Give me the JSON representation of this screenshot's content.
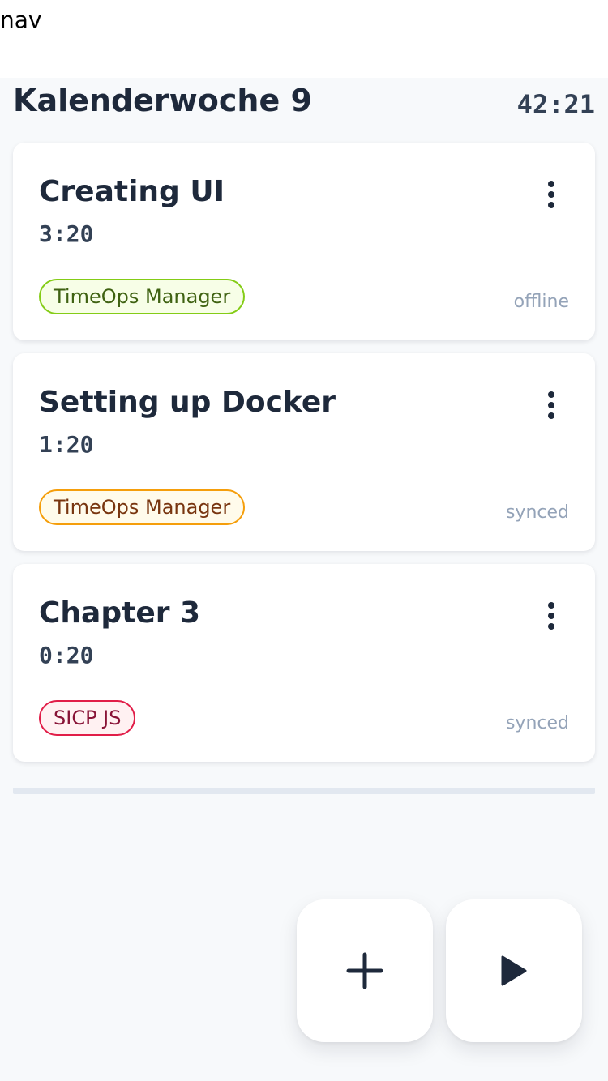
{
  "nav": {
    "label": "nav"
  },
  "week": {
    "title": "Kalenderwoche 9",
    "total": "42:21"
  },
  "entries": [
    {
      "title": "Creating UI",
      "duration": "3:20",
      "tag": "TimeOps Manager",
      "tag_colors": {
        "border": "#84cc16",
        "background": "#f7fee7",
        "text": "#3f6212"
      },
      "status": "offline"
    },
    {
      "title": "Setting up Docker",
      "duration": "1:20",
      "tag": "TimeOps Manager",
      "tag_colors": {
        "border": "#f59e0b",
        "background": "#fffbeb",
        "text": "#78350f"
      },
      "status": "synced"
    },
    {
      "title": "Chapter 3",
      "duration": "0:20",
      "tag": "SICP JS",
      "tag_colors": {
        "border": "#e11d48",
        "background": "#fff1f2",
        "text": "#881337"
      },
      "status": "synced"
    }
  ],
  "actions": {
    "add_icon": "plus-icon",
    "start_icon": "play-icon"
  },
  "colors": {
    "text_primary": "#1e293b",
    "text_muted": "#94a3b8",
    "background": "#f7f9fb"
  }
}
